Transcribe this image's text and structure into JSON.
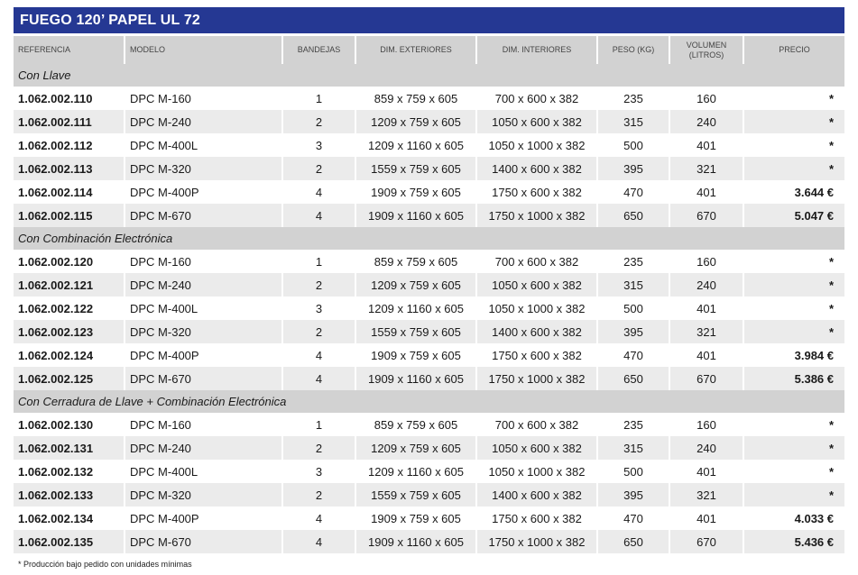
{
  "title": "FUEGO 120’ PAPEL UL 72",
  "headers": {
    "referencia": "REFERENCIA",
    "modelo": "MODELO",
    "bandejas": "BANDEJAS",
    "dim_ext": "DIM. EXTERIORES",
    "dim_int": "DIM. INTERIORES",
    "peso": "PESO (KG)",
    "volumen_1": "VOLUMEN",
    "volumen_2": "(LITROS)",
    "precio": "PRECIO"
  },
  "groups": [
    {
      "name": "Con Llave",
      "rows": [
        {
          "ref": "1.062.002.110",
          "model": "DPC M-160",
          "trays": "1",
          "ext": "859 x 759 x 605",
          "int": "700 x 600 x 382",
          "weight": "235",
          "volume": "160",
          "price": "*"
        },
        {
          "ref": "1.062.002.111",
          "model": "DPC M-240",
          "trays": "2",
          "ext": "1209 x 759 x 605",
          "int": "1050 x 600 x 382",
          "weight": "315",
          "volume": "240",
          "price": "*"
        },
        {
          "ref": "1.062.002.112",
          "model": "DPC M-400L",
          "trays": "3",
          "ext": "1209 x 1160 x 605",
          "int": "1050 x 1000 x 382",
          "weight": "500",
          "volume": "401",
          "price": "*"
        },
        {
          "ref": "1.062.002.113",
          "model": "DPC M-320",
          "trays": "2",
          "ext": "1559 x 759 x 605",
          "int": "1400 x 600 x 382",
          "weight": "395",
          "volume": "321",
          "price": "*"
        },
        {
          "ref": "1.062.002.114",
          "model": "DPC M-400P",
          "trays": "4",
          "ext": "1909 x 759 x 605",
          "int": "1750 x 600 x 382",
          "weight": "470",
          "volume": "401",
          "price": "3.644 €"
        },
        {
          "ref": "1.062.002.115",
          "model": "DPC M-670",
          "trays": "4",
          "ext": "1909 x 1160 x 605",
          "int": "1750 x 1000 x 382",
          "weight": "650",
          "volume": "670",
          "price": "5.047 €"
        }
      ]
    },
    {
      "name": "Con Combinación Electrónica",
      "rows": [
        {
          "ref": "1.062.002.120",
          "model": "DPC M-160",
          "trays": "1",
          "ext": "859 x 759 x 605",
          "int": "700 x 600 x 382",
          "weight": "235",
          "volume": "160",
          "price": "*"
        },
        {
          "ref": "1.062.002.121",
          "model": "DPC M-240",
          "trays": "2",
          "ext": "1209 x 759 x 605",
          "int": "1050 x 600 x 382",
          "weight": "315",
          "volume": "240",
          "price": "*"
        },
        {
          "ref": "1.062.002.122",
          "model": "DPC M-400L",
          "trays": "3",
          "ext": "1209 x 1160 x 605",
          "int": "1050 x 1000 x 382",
          "weight": "500",
          "volume": "401",
          "price": "*"
        },
        {
          "ref": "1.062.002.123",
          "model": "DPC M-320",
          "trays": "2",
          "ext": "1559 x 759 x 605",
          "int": "1400 x 600 x 382",
          "weight": "395",
          "volume": "321",
          "price": "*"
        },
        {
          "ref": "1.062.002.124",
          "model": "DPC M-400P",
          "trays": "4",
          "ext": "1909 x 759 x 605",
          "int": "1750 x 600 x 382",
          "weight": "470",
          "volume": "401",
          "price": "3.984 €"
        },
        {
          "ref": "1.062.002.125",
          "model": "DPC M-670",
          "trays": "4",
          "ext": "1909 x 1160 x 605",
          "int": "1750 x 1000 x 382",
          "weight": "650",
          "volume": "670",
          "price": "5.386 €"
        }
      ]
    },
    {
      "name": "Con Cerradura de Llave + Combinación Electrónica",
      "rows": [
        {
          "ref": "1.062.002.130",
          "model": "DPC M-160",
          "trays": "1",
          "ext": "859 x 759 x 605",
          "int": "700 x 600 x 382",
          "weight": "235",
          "volume": "160",
          "price": "*"
        },
        {
          "ref": "1.062.002.131",
          "model": "DPC M-240",
          "trays": "2",
          "ext": "1209 x 759 x 605",
          "int": "1050 x 600 x 382",
          "weight": "315",
          "volume": "240",
          "price": "*"
        },
        {
          "ref": "1.062.002.132",
          "model": "DPC M-400L",
          "trays": "3",
          "ext": "1209 x 1160 x 605",
          "int": "1050 x 1000 x 382",
          "weight": "500",
          "volume": "401",
          "price": "*"
        },
        {
          "ref": "1.062.002.133",
          "model": "DPC M-320",
          "trays": "2",
          "ext": "1559 x 759 x 605",
          "int": "1400 x 600 x 382",
          "weight": "395",
          "volume": "321",
          "price": "*"
        },
        {
          "ref": "1.062.002.134",
          "model": "DPC M-400P",
          "trays": "4",
          "ext": "1909 x 759 x 605",
          "int": "1750 x 600 x 382",
          "weight": "470",
          "volume": "401",
          "price": "4.033 €"
        },
        {
          "ref": "1.062.002.135",
          "model": "DPC M-670",
          "trays": "4",
          "ext": "1909 x 1160 x 605",
          "int": "1750 x 1000 x 382",
          "weight": "650",
          "volume": "670",
          "price": "5.436 €"
        }
      ]
    }
  ],
  "footnote": "* Producción bajo pedido con unidades mínimas",
  "colors": {
    "title_bg": "#253893",
    "header_bg": "#d2d2d2",
    "row_alt_bg": "#ebebeb"
  }
}
